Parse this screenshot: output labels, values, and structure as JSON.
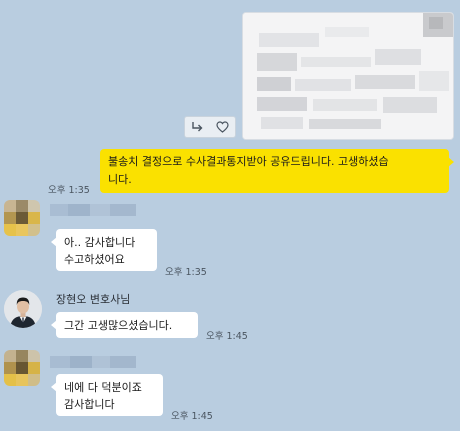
{
  "shared_image": {
    "forward_icon": "forward-arrow-icon",
    "like_icon": "heart-icon"
  },
  "messages": [
    {
      "sender": "me",
      "text": "불송치 결정으로 수사결과통지받아 공유드립니다. 고생하셨습\n니다.",
      "time": "오후 1:35"
    },
    {
      "sender": "other",
      "text": "아.. 감사합니다\n수고하셨어요",
      "time": "오후 1:35"
    },
    {
      "sender": "other",
      "name": "장현오 변호사님",
      "text": "그간 고생많으셨습니다.",
      "time": "오후 1:45"
    },
    {
      "sender": "other",
      "text": "네에 다 덕분이죠\n감사합니다",
      "time": "오후 1:45"
    }
  ],
  "colors": {
    "background": "#b9cde0",
    "my_bubble": "#fae100",
    "other_bubble": "#ffffff"
  }
}
